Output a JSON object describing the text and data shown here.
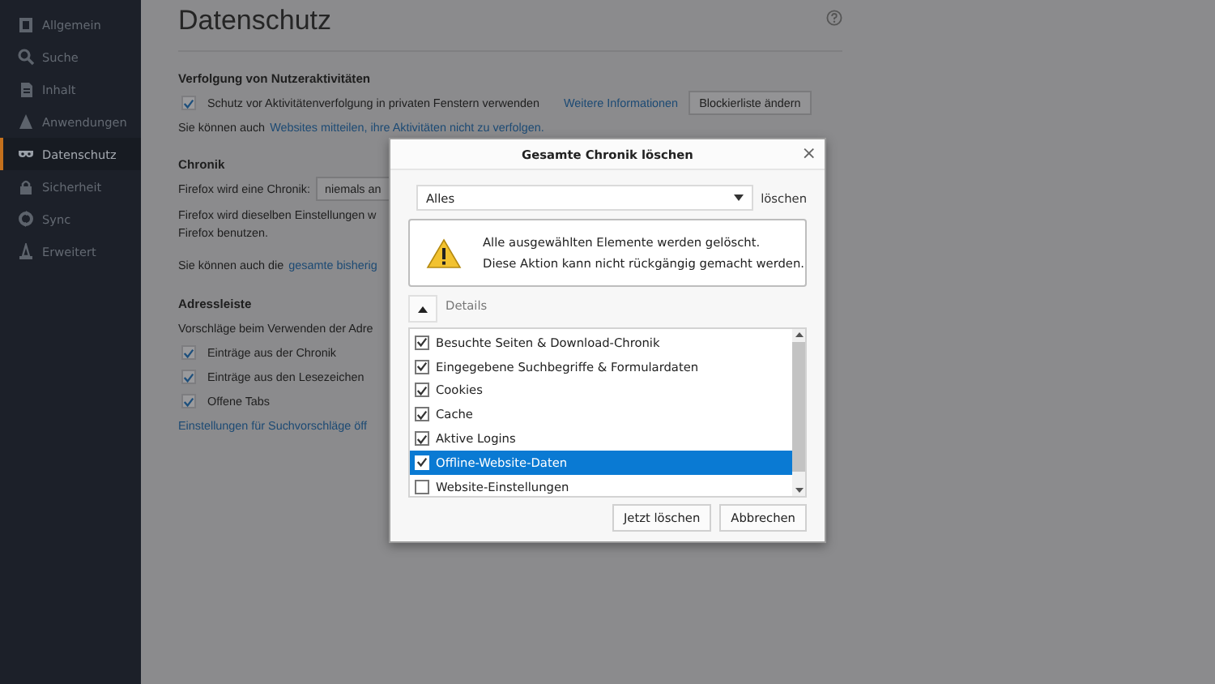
{
  "sidebar": {
    "items": [
      {
        "label": "Allgemein",
        "selected": false
      },
      {
        "label": "Suche",
        "selected": false
      },
      {
        "label": "Inhalt",
        "selected": false
      },
      {
        "label": "Anwendungen",
        "selected": false
      },
      {
        "label": "Datenschutz",
        "selected": true
      },
      {
        "label": "Sicherheit",
        "selected": false
      },
      {
        "label": "Sync",
        "selected": false
      },
      {
        "label": "Erweitert",
        "selected": false
      }
    ]
  },
  "page": {
    "title": "Datenschutz"
  },
  "tracking": {
    "heading": "Verfolgung von Nutzeraktivitäten",
    "checkbox": {
      "label": "Schutz vor Aktivitätenverfolgung in privaten Fenstern verwenden",
      "checked": true
    },
    "link": "Weitere Informationen",
    "button": "Blockierliste ändern",
    "note": {
      "text": "Sie können auch",
      "link": "Websites mitteilen, ihre Aktivitäten nicht zu verfolgen."
    }
  },
  "history": {
    "heading": "Chronik",
    "mode_label": "Firefox wird eine Chronik:",
    "mode_value": "niemals an",
    "note_lines": [
      "Firefox wird dieselben Einstellungen w",
      "Firefox benutzen."
    ],
    "clear_note": {
      "text": "Sie können auch die",
      "link": "gesamte bisherig"
    }
  },
  "address_bar": {
    "heading": "Adressleiste",
    "intro": "Vorschläge beim Verwenden der Adre",
    "options": [
      {
        "label": "Einträge aus der Chronik",
        "checked": true
      },
      {
        "label": "Einträge aus den Lesezeichen",
        "checked": true
      },
      {
        "label": "Offene Tabs",
        "checked": true
      }
    ],
    "link": "Einstellungen für Suchvorschläge öff"
  },
  "dialog": {
    "title": "Gesamte Chronik löschen",
    "close": "×",
    "range": {
      "value": "Alles",
      "label": "löschen"
    },
    "warning": [
      "Alle ausgewählten Elemente werden gelöscht.",
      "Diese Aktion kann nicht rückgängig gemacht werden."
    ],
    "details": {
      "label": "Details",
      "expanded": true
    },
    "items": [
      {
        "label": "Besuchte Seiten & Download-Chronik",
        "checked": true,
        "selected": false
      },
      {
        "label": "Eingegebene Suchbegriffe & Formulardaten",
        "checked": true,
        "selected": false
      },
      {
        "label": "Cookies",
        "checked": true,
        "selected": false
      },
      {
        "label": "Cache",
        "checked": true,
        "selected": false
      },
      {
        "label": "Aktive Logins",
        "checked": true,
        "selected": false
      },
      {
        "label": "Offline-Website-Daten",
        "checked": true,
        "selected": true
      },
      {
        "label": "Website-Einstellungen",
        "checked": false,
        "selected": false
      }
    ],
    "buttons": [
      "Jetzt löschen",
      "Abbrechen"
    ]
  }
}
